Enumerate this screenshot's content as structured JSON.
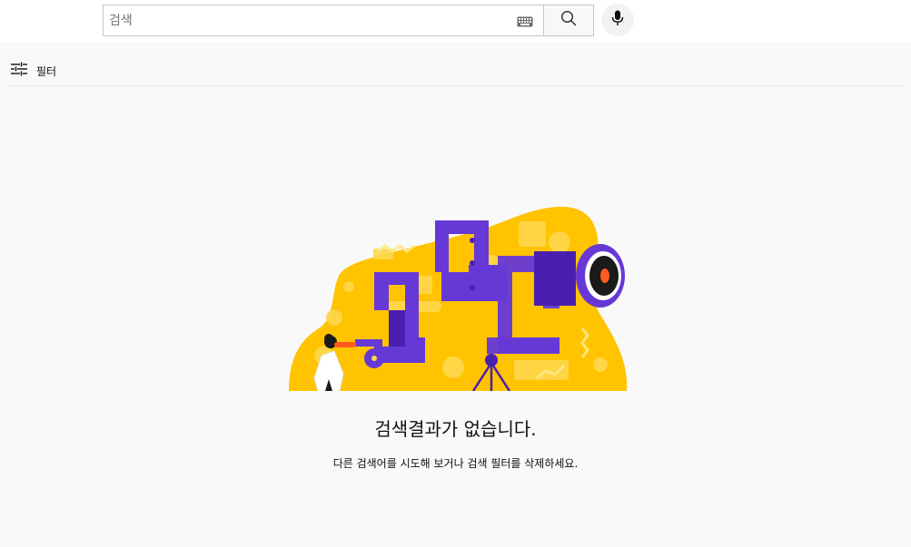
{
  "search": {
    "placeholder": "검색",
    "keyboard_icon": "keyboard-icon",
    "search_icon": "search-icon",
    "mic_icon": "microphone-icon"
  },
  "filters": {
    "label": "필터",
    "icon": "tune-sliders-icon"
  },
  "empty_state": {
    "illustration": "telescope-empty-results-illustration",
    "title": "검색결과가 없습니다.",
    "subtitle": "다른 검색어를 시도해 보거나 검색 필터를 삭제하세요."
  },
  "colors": {
    "page_background": "#f9f9f9",
    "header_background": "#ffffff",
    "illustration_yellow": "#ffc300",
    "illustration_purple": "#6638d6"
  }
}
